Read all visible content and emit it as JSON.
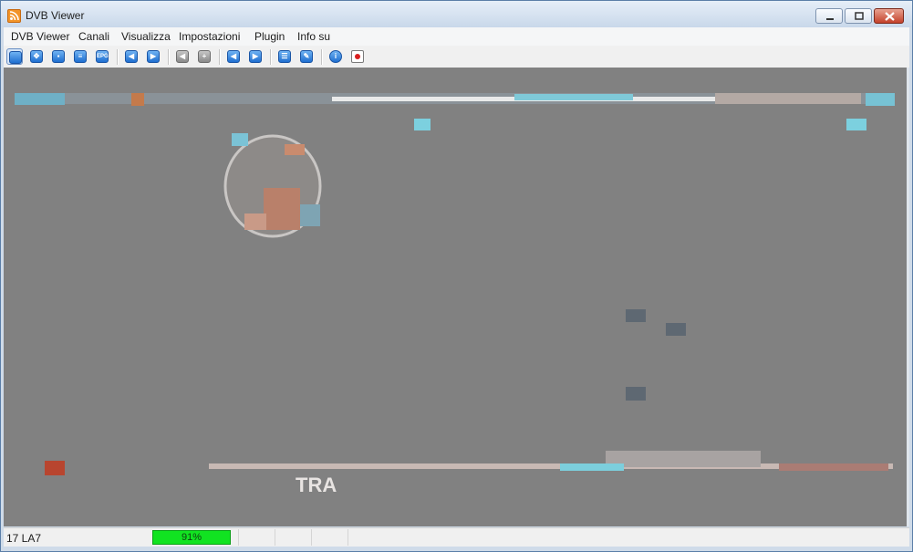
{
  "window": {
    "title": "DVB Viewer",
    "icon": "rss-icon",
    "controls": [
      "minimize-icon",
      "restore-icon",
      "close-icon"
    ]
  },
  "menu": {
    "items": [
      "DVB Viewer",
      "Canali",
      "Visualizza",
      "Impostazioni",
      "Plugin",
      "Info su"
    ]
  },
  "toolbar": {
    "buttons": [
      {
        "name": "fullscreen-icon",
        "glyph": "",
        "active": true
      },
      {
        "name": "move-icon",
        "glyph": "✥"
      },
      {
        "name": "pin-icon",
        "glyph": "▪"
      },
      {
        "name": "list-icon",
        "glyph": "≡"
      },
      {
        "name": "epg-icon",
        "glyph": "EPG"
      },
      {
        "name": "channel-down-icon",
        "glyph": "◀"
      },
      {
        "name": "channel-up-icon",
        "glyph": "▶"
      },
      {
        "name": "audio-down-icon",
        "glyph": "◀",
        "gray": true
      },
      {
        "name": "audio-up-icon",
        "glyph": "+",
        "gray": true
      },
      {
        "name": "back-icon",
        "glyph": "◀"
      },
      {
        "name": "forward-icon",
        "glyph": "▶"
      },
      {
        "name": "teletext-icon",
        "glyph": "☰"
      },
      {
        "name": "settings-icon",
        "glyph": "✎"
      },
      {
        "name": "info-icon",
        "glyph": "i"
      },
      {
        "name": "record-icon",
        "glyph": "",
        "rec": true
      }
    ]
  },
  "video": {
    "overlay_text": "TRA"
  },
  "status": {
    "channel": "17 LA7",
    "signal_label": "91%",
    "signal_level": 91
  }
}
